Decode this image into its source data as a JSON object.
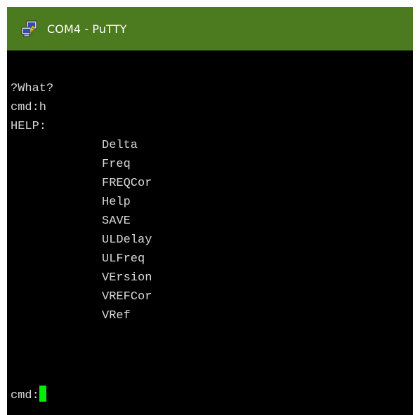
{
  "window": {
    "title": "COM4 - PuTTY",
    "icon": "putty-icon",
    "title_bar_color": "#4c7a1f"
  },
  "terminal": {
    "background": "#000000",
    "text_color": "#d8d8d8",
    "cursor_color": "#00ee00",
    "lines": [
      "?What?",
      "cmd:h",
      "HELP:"
    ],
    "help_commands": [
      "Delta",
      "Freq",
      "FREQCor",
      "Help",
      "SAVE",
      "ULDelay",
      "ULFreq",
      "VErsion",
      "VREFCor",
      "VRef"
    ],
    "prompt": "cmd:"
  }
}
